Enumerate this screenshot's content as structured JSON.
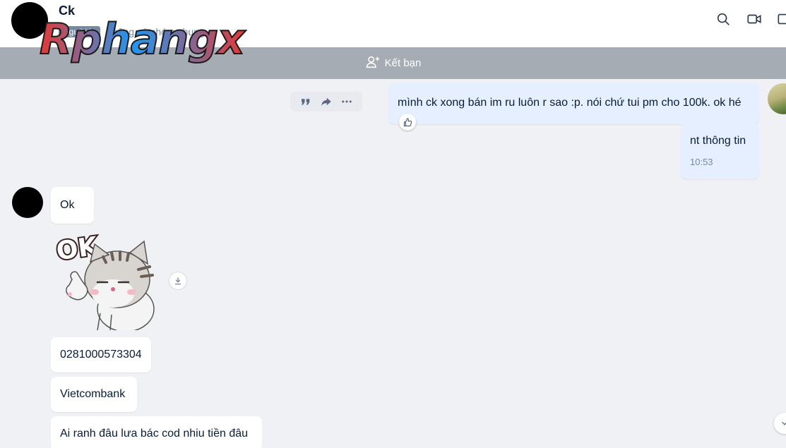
{
  "header": {
    "contact_name": "Ck",
    "stranger_tag": "Người lạ",
    "mutual_groups": "Không có nhóm chung"
  },
  "watermark": {
    "text": "Rphangx"
  },
  "friend_bar": {
    "label": "Kết bạn"
  },
  "messages": {
    "sent_1": "mình ck xong bán im ru luôn r sao :p. nói chứ tui pm cho 100k. ok hé",
    "sent_2": "nt thông tin",
    "sent_2_time": "10:53",
    "recv_1": "Ok",
    "recv_sticker": "OK",
    "recv_2": "0281000573304",
    "recv_3": "Vietcombank",
    "recv_4": "Ai ranh đâu lưa bác cod nhiu tiền đâu"
  },
  "icons": {
    "search": "search-icon",
    "video": "video-call-icon",
    "sidebar": "sidebar-toggle-icon",
    "add_friend": "user-plus-icon",
    "quote": "quote-icon",
    "forward": "forward-icon",
    "more": "more-icon",
    "like": "thumbs-up-icon",
    "download": "download-icon",
    "scroll": "chevron-down-icon"
  },
  "colors": {
    "sent_bubble": "#e5efff",
    "received_bubble": "#ffffff",
    "friend_bar": "#a6acb4",
    "background": "#f0f1f4"
  }
}
